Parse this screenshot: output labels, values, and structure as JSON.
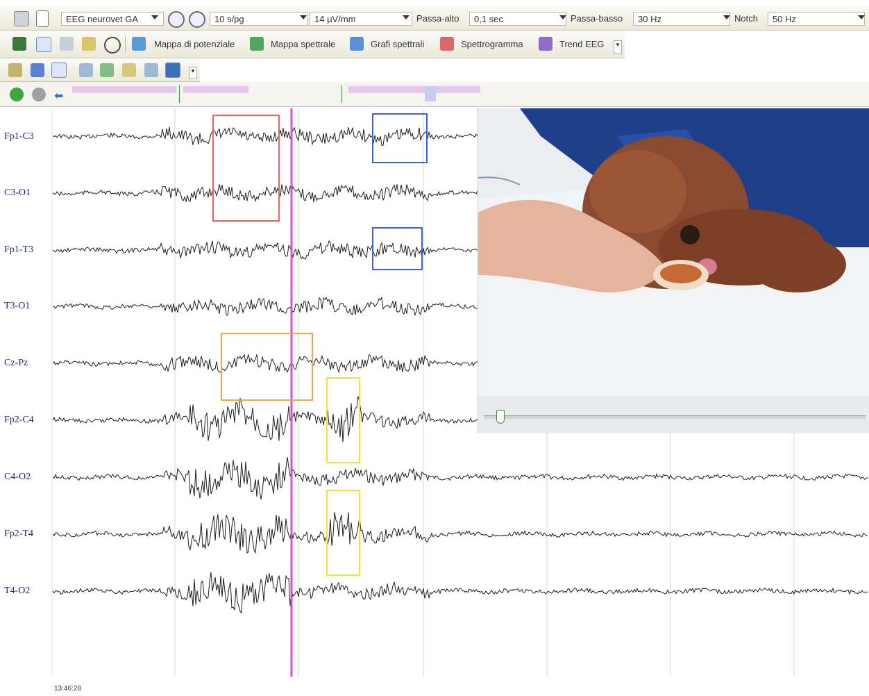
{
  "toolbar": {
    "montage": "EEG neurovet GA",
    "speed": "10 s/pg",
    "sensitivity": "14 μV/mm",
    "highpass_label": "Passa-alto",
    "highpass_value": "0,1 sec",
    "lowpass_label": "Passa-basso",
    "lowpass_value": "30 Hz",
    "notch_label": "Notch",
    "notch_value": "50 Hz"
  },
  "analysis_tools": {
    "potential_map": "Mappa di potenziale",
    "spectral_map": "Mappa spettrale",
    "spectral_graphs": "Grafi spettrali",
    "spectrogram": "Spettrogramma",
    "eeg_trend": "Trend EEG"
  },
  "channels": [
    "Fp1-C3",
    "C3-O1",
    "Fp1-T3",
    "T3-O1",
    "Cz-Pz",
    "Fp2-C4",
    "C4-O2",
    "Fp2-T4",
    "T4-O2"
  ],
  "time_label": "13:46:28",
  "colors": {
    "trace": "#1c1c1c",
    "cursor": "#d64fd6",
    "box_red": "#f06060",
    "box_blue": "#3a5cf0",
    "box_orange": "#f2a24a",
    "box_yellow": "#f2e23a",
    "channel_label": "#1a2a7a",
    "timeline_segment": "#e6c8ef"
  }
}
